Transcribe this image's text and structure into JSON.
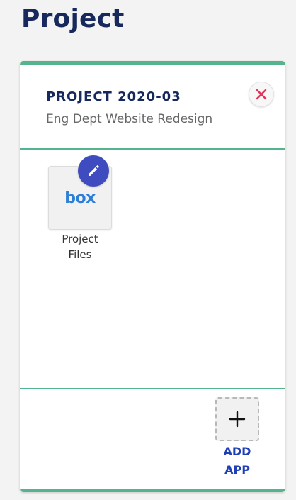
{
  "header": {
    "title": "Project"
  },
  "project_card": {
    "code": "PROJECT 2020-03",
    "name": "Eng Dept Website Redesign",
    "close_icon": "close-x-icon",
    "accent_color": "#55b38e",
    "apps": [
      {
        "logo_text": "box",
        "label_line1": "Project",
        "label_line2": "Files",
        "edit_icon": "pencil-icon"
      }
    ],
    "add_app": {
      "icon": "plus-icon",
      "label_line1": "ADD",
      "label_line2": "APP"
    }
  },
  "colors": {
    "title": "#17295c",
    "close_icon": "#e0345a",
    "edit_button": "#3e4cc0",
    "box_logo": "#2c7ed6",
    "add_app_label": "#1f3fb6"
  }
}
